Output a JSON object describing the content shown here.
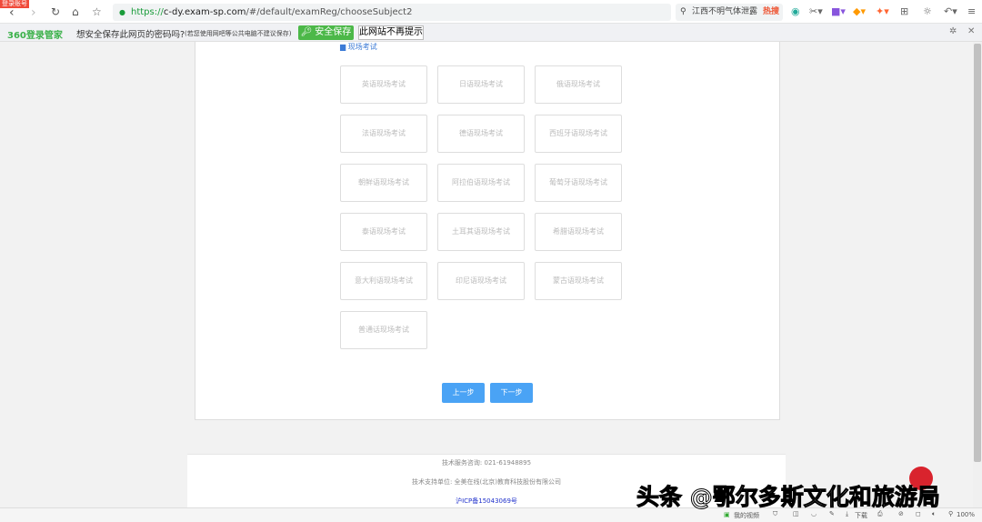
{
  "browser": {
    "badge": "登录账号",
    "url_scheme": "https://",
    "url_host": "c-dy.exam-sp.com",
    "url_path": "/#/default/examReg/chooseSubject2",
    "search_text": "江西不明气体泄露",
    "hot_label": "热搜"
  },
  "password_bar": {
    "logo": "360登录管家",
    "question": "想安全保存此网页的密码吗?",
    "note": "(若您使用网吧等公共电脑不建议保存)",
    "save_label": "安全保存",
    "never_label": "此网站不再提示"
  },
  "section_label": "▆ 现场考试",
  "exams": [
    "英语现场考试",
    "日语现场考试",
    "俄语现场考试",
    "法语现场考试",
    "德语现场考试",
    "西班牙语现场考试",
    "朝鲜语现场考试",
    "阿拉伯语现场考试",
    "葡萄牙语现场考试",
    "泰语现场考试",
    "土耳其语现场考试",
    "希腊语现场考试",
    "意大利语现场考试",
    "印尼语现场考试",
    "蒙古语现场考试",
    "普通话现场考试"
  ],
  "buttons": {
    "prev": "上一步",
    "next": "下一步"
  },
  "footer": {
    "hotline": "技术服务咨询: 021-61948895",
    "support": "技术支持单位: 全美在线(北京)教育科技股份有限公司",
    "icp": "沪ICP备15043069号"
  },
  "status": {
    "video": "我的视频",
    "download": "下载",
    "zoom": "100%"
  },
  "watermark": "头条 @鄂尔多斯文化和旅游局"
}
